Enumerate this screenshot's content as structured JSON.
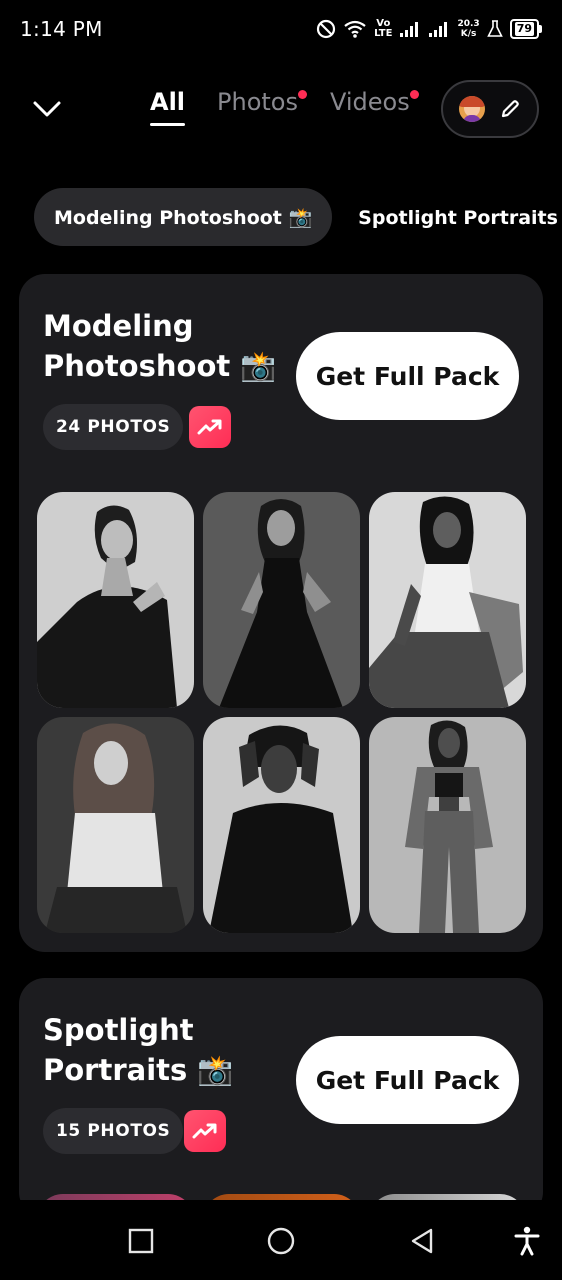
{
  "status_bar": {
    "time": "1:14 PM",
    "network_label_top": "Vo",
    "network_label_bottom": "LTE",
    "speed_value": "20.3",
    "speed_unit": "K/s",
    "battery_level": "79",
    "icons": [
      "do-not-disturb-icon",
      "wifi-icon",
      "signal-icon",
      "signal-icon",
      "lab-icon",
      "battery-icon"
    ]
  },
  "header": {
    "tabs": [
      {
        "label": "All",
        "active": true,
        "has_dot": false
      },
      {
        "label": "Photos",
        "active": false,
        "has_dot": true
      },
      {
        "label": "Videos",
        "active": false,
        "has_dot": true
      }
    ]
  },
  "chips": [
    {
      "label": "Modeling Photoshoot 📸",
      "selected": true
    },
    {
      "label": "Spotlight Portraits 📸",
      "selected": false
    }
  ],
  "packs": [
    {
      "title": "Modeling Photoshoot 📸",
      "count_label": "24 PHOTOS",
      "cta_label": "Get Full Pack"
    },
    {
      "title": "Spotlight Portraits 📸",
      "count_label": "15 PHOTOS",
      "cta_label": "Get Full Pack"
    }
  ],
  "colors": {
    "background": "#000000",
    "card": "#1c1c1f",
    "accent_dot": "#ff2d55",
    "trend_badge": "#ff3b5c"
  }
}
